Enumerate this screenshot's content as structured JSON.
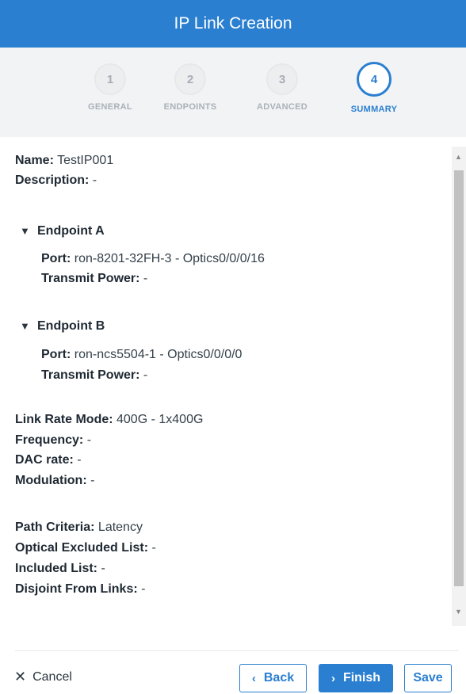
{
  "header": {
    "title": "IP Link Creation"
  },
  "steps": [
    {
      "number": "1",
      "label": "GENERAL"
    },
    {
      "number": "2",
      "label": "ENDPOINTS"
    },
    {
      "number": "3",
      "label": "ADVANCED"
    },
    {
      "number": "4",
      "label": "SUMMARY"
    }
  ],
  "summary": {
    "name_label": "Name:",
    "name_value": " TestIP001",
    "description_label": "Description:",
    "description_value": " -",
    "endpoint_a": {
      "title": "Endpoint A",
      "port_label": "Port:",
      "port_value": " ron-8201-32FH-3 - Optics0/0/0/16",
      "power_label": "Transmit Power:",
      "power_value": " -"
    },
    "endpoint_b": {
      "title": "Endpoint B",
      "port_label": "Port:",
      "port_value": " ron-ncs5504-1 - Optics0/0/0/0",
      "power_label": "Transmit Power:",
      "power_value": " -"
    },
    "link_rate_label": "Link Rate Mode:",
    "link_rate_value": " 400G - 1x400G",
    "frequency_label": "Frequency:",
    "frequency_value": " -",
    "dac_label": "DAC rate:",
    "dac_value": " -",
    "modulation_label": "Modulation:",
    "modulation_value": " -",
    "path_criteria_label": "Path Criteria:",
    "path_criteria_value": " Latency",
    "optical_excluded_label": "Optical Excluded List:",
    "optical_excluded_value": " -",
    "included_label": "Included List:",
    "included_value": " -",
    "disjoint_label": "Disjoint From Links:",
    "disjoint_value": " -"
  },
  "footer": {
    "cancel_label": "Cancel",
    "back_label": "Back",
    "finish_label": "Finish",
    "save_label": "Save"
  },
  "colors": {
    "accent": "#2a7fd0"
  }
}
